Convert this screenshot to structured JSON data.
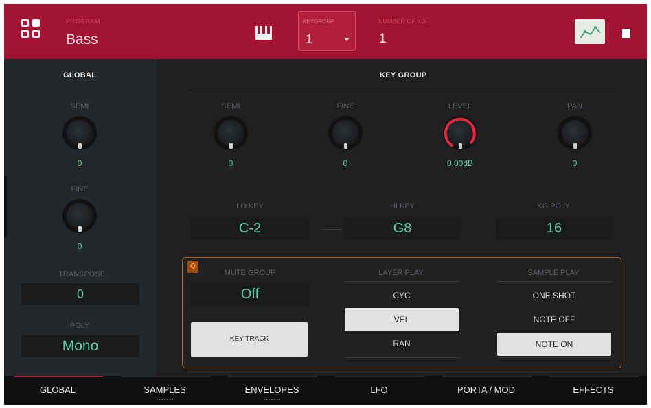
{
  "header": {
    "program_label": "PROGRAM",
    "program_value": "Bass",
    "keygroup_label": "KEYGROUP",
    "keygroup_value": "1",
    "num_keygroups_label": "NUMBER OF KG",
    "num_keygroups_value": "1"
  },
  "global": {
    "title": "GLOBAL",
    "semi_label": "SEMI",
    "semi_value": "0",
    "fine_label": "FINE",
    "fine_value": "0",
    "transpose_label": "TRANSPOSE",
    "transpose_value": "0",
    "poly_label": "POLY",
    "poly_value": "Mono"
  },
  "keygroup": {
    "title": "KEY GROUP",
    "semi_label": "SEMI",
    "semi_value": "0",
    "fine_label": "FINE",
    "fine_value": "0",
    "level_label": "LEVEL",
    "level_value": "0.00dB",
    "pan_label": "PAN",
    "pan_value": "0",
    "lo_key_label": "LO KEY",
    "lo_key_value": "C-2",
    "hi_key_label": "HI KEY",
    "hi_key_value": "G8",
    "kg_poly_label": "KG POLY",
    "kg_poly_value": "16"
  },
  "panel": {
    "q_badge": "Q",
    "mute_group_label": "MUTE GROUP",
    "mute_group_value": "Off",
    "key_track_label": "KEY TRACK",
    "layer_play_label": "LAYER PLAY",
    "layer_play_options": [
      "CYC",
      "VEL",
      "RAN"
    ],
    "layer_play_selected": "VEL",
    "sample_play_label": "SAMPLE PLAY",
    "sample_play_options": [
      "ONE SHOT",
      "NOTE OFF",
      "NOTE ON"
    ],
    "sample_play_selected": "NOTE ON"
  },
  "tabs": [
    {
      "label": "GLOBAL"
    },
    {
      "label": "SAMPLES"
    },
    {
      "label": "ENVELOPES"
    },
    {
      "label": "LFO"
    },
    {
      "label": "PORTA / MOD"
    },
    {
      "label": "EFFECTS"
    }
  ],
  "active_tab": "GLOBAL",
  "colors": {
    "header_bg": "#a31432",
    "value_green": "#5ecfa7",
    "level_arc": "#e2283c",
    "panel_border": "#a7622b"
  },
  "icons": {
    "menu": "grid-icon",
    "keyboard": "keyboard-icon",
    "envelope": "envelope-view-icon",
    "memory": "chip-icon"
  }
}
